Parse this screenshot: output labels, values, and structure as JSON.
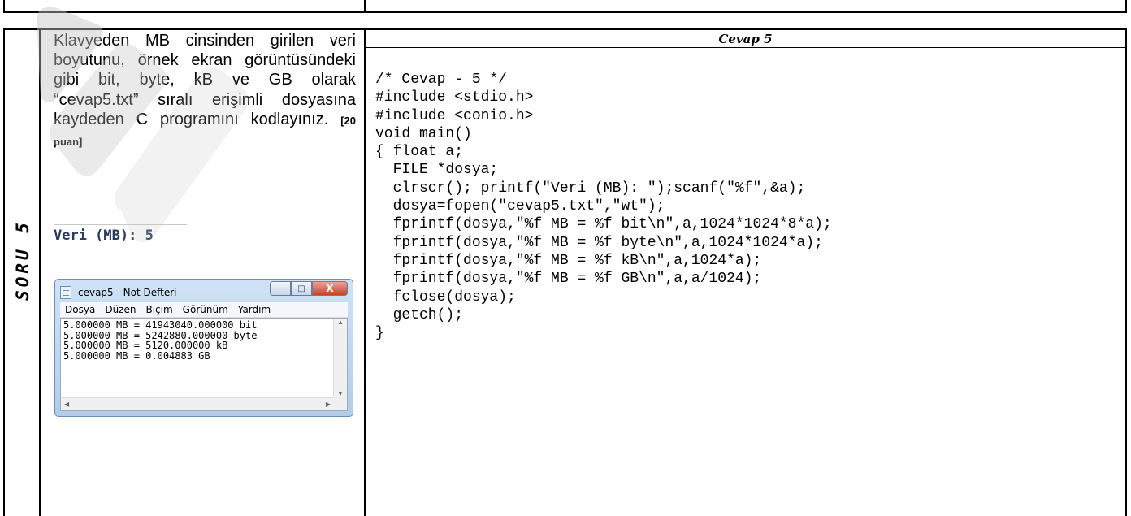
{
  "section_label": "SORU 5",
  "question": {
    "text": "Klavyeden MB cinsinden girilen veri boyutunu, örnek ekran görüntüsündeki gibi bit, byte, kB ve GB olarak “cevap5.txt” sıralı erişimli dosyasına kaydeden C programını kodlayınız.",
    "points": "[20 puan]"
  },
  "console_output": "Veri (MB): 5",
  "notepad": {
    "title": "cevap5 - Not Defteri",
    "buttons": {
      "minimize": "─",
      "maximize": "□",
      "close": "X"
    },
    "menu": [
      "Dosya",
      "Düzen",
      "Biçim",
      "Görünüm",
      "Yardım"
    ],
    "content": "5.000000 MB = 41943040.000000 bit\n5.000000 MB = 5242880.000000 byte\n5.000000 MB = 5120.000000 kB\n5.000000 MB = 0.004883 GB"
  },
  "answer": {
    "header": "Cevap 5",
    "code": "/* Cevap - 5 */\n#include <stdio.h>\n#include <conio.h>\nvoid main()\n{ float a;\n  FILE *dosya;\n  clrscr(); printf(\"Veri (MB): \");scanf(\"%f\",&a);\n  dosya=fopen(\"cevap5.txt\",\"wt\");\n  fprintf(dosya,\"%f MB = %f bit\\n\",a,1024*1024*8*a);\n  fprintf(dosya,\"%f MB = %f byte\\n\",a,1024*1024*a);\n  fprintf(dosya,\"%f MB = %f kB\\n\",a,1024*a);\n  fprintf(dosya,\"%f MB = %f GB\\n\",a,a/1024);\n  fclose(dosya);\n  getch();\n}"
  },
  "watermark_color": "#c4c4c4"
}
